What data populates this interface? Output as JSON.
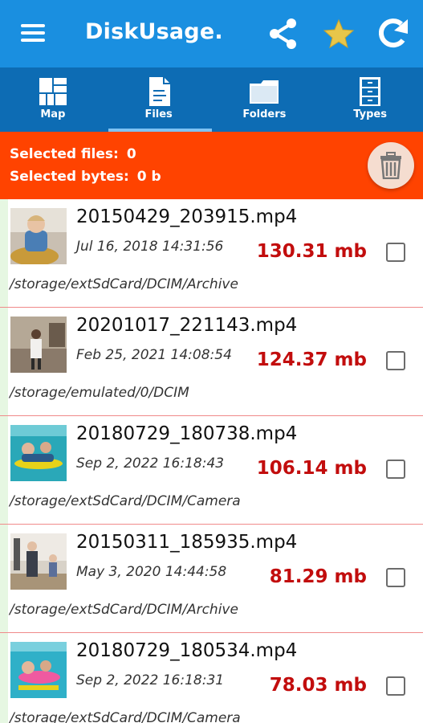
{
  "app": {
    "title": "DiskUsage.",
    "colors": {
      "appbar": "#1a8fe0",
      "tabs": "#0d6cb4",
      "selection_bar": "#ff4300",
      "size_text": "#c20d0d"
    },
    "actions": [
      "menu-icon",
      "share-icon",
      "star-icon",
      "refresh-icon"
    ]
  },
  "tabs": [
    {
      "label": "Map",
      "icon": "map-icon",
      "active": false
    },
    {
      "label": "Files",
      "icon": "file-icon",
      "active": true
    },
    {
      "label": "Folders",
      "icon": "folder-icon",
      "active": false
    },
    {
      "label": "Types",
      "icon": "cabinet-icon",
      "active": false
    }
  ],
  "selection": {
    "files_label": "Selected files:",
    "files_value": "0",
    "bytes_label": "Selected bytes:",
    "bytes_value": "0 b"
  },
  "files": [
    {
      "name": "20150429_203915.mp4",
      "date": "Jul 16, 2018 14:31:56",
      "size": "130.31 mb",
      "path": "/storage/extSdCard/DCIM/Archive",
      "checked": false
    },
    {
      "name": "20201017_221143.mp4",
      "date": "Feb 25, 2021 14:08:54",
      "size": "124.37 mb",
      "path": "/storage/emulated/0/DCIM",
      "checked": false
    },
    {
      "name": "20180729_180738.mp4",
      "date": "Sep 2, 2022 16:18:43",
      "size": "106.14 mb",
      "path": "/storage/extSdCard/DCIM/Camera",
      "checked": false
    },
    {
      "name": "20150311_185935.mp4",
      "date": "May 3, 2020 14:44:58",
      "size": "81.29 mb",
      "path": "/storage/extSdCard/DCIM/Archive",
      "checked": false
    },
    {
      "name": "20180729_180534.mp4",
      "date": "Sep 2, 2022 16:18:31",
      "size": "78.03 mb",
      "path": "/storage/extSdCard/DCIM/Camera",
      "checked": false
    }
  ]
}
